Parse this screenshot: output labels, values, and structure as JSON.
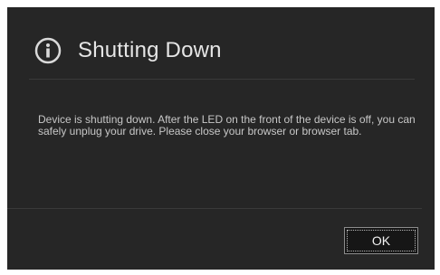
{
  "dialog": {
    "title": "Shutting Down",
    "icon": "info-icon",
    "message": "Device is shutting down. After the LED on the front of the device is off, you can safely unplug your drive. Please close your browser or browser tab.",
    "ok_label": "OK"
  },
  "colors": {
    "dialog_background": "#262626",
    "text": "#c7c7c7",
    "title": "#e6e6e6"
  }
}
